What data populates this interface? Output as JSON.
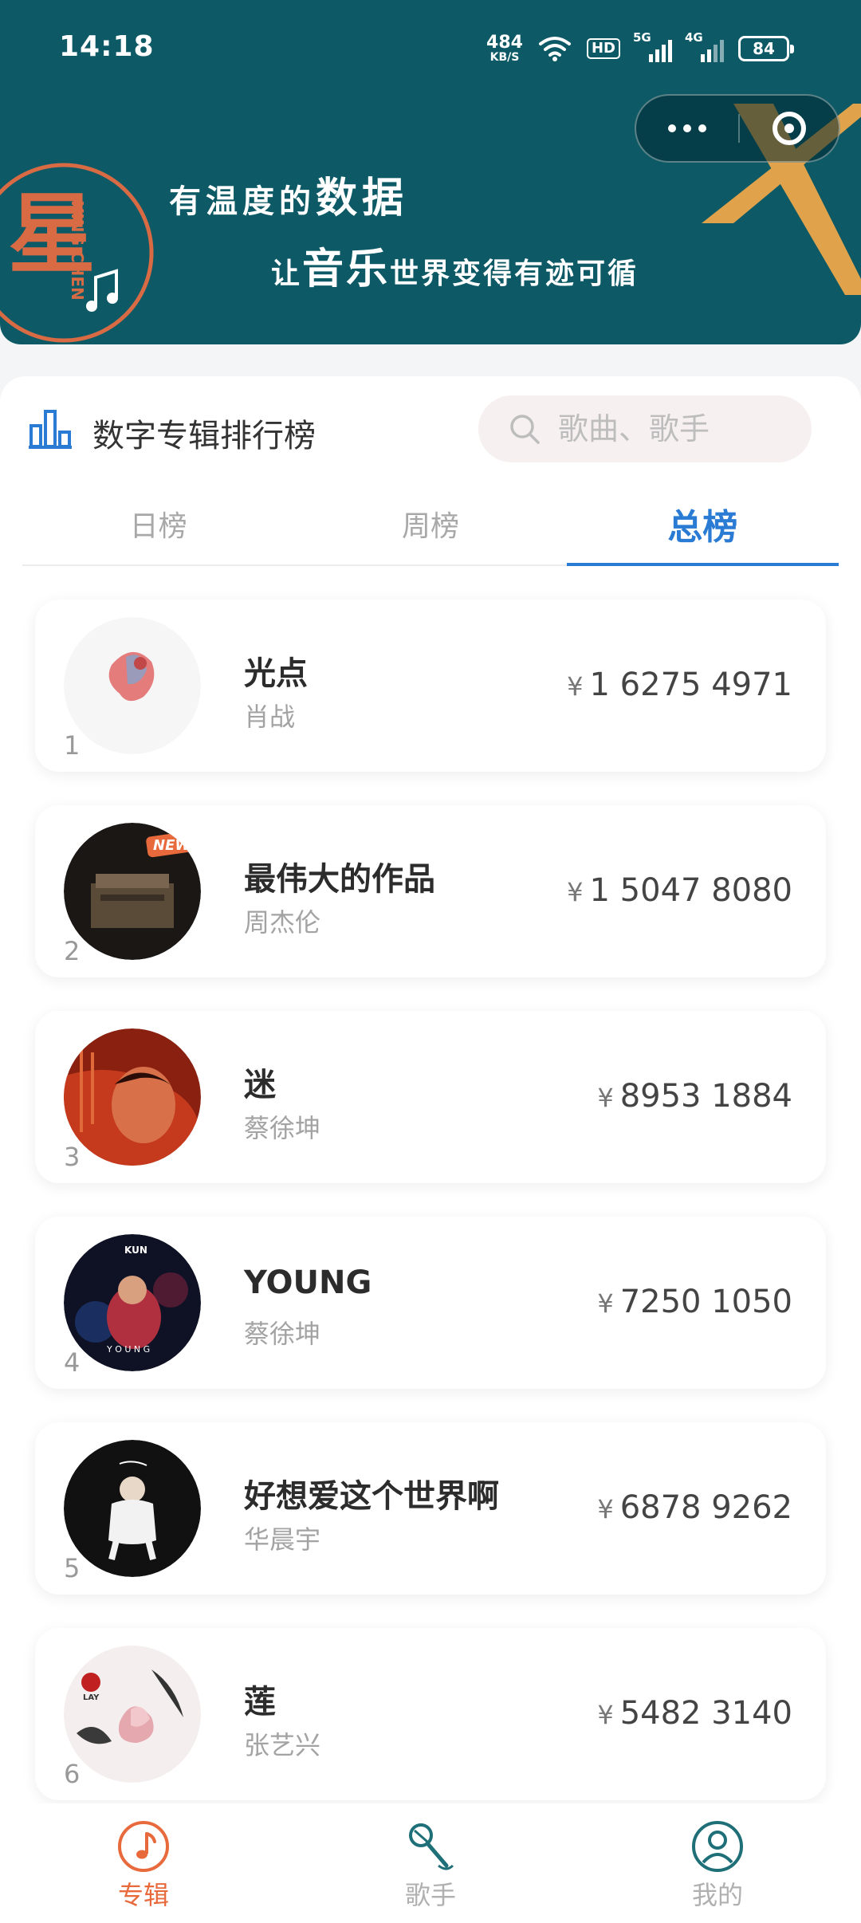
{
  "status_bar": {
    "time": "14:18",
    "net_speed_value": "484",
    "net_speed_unit": "KB/S",
    "hd_label": "HD",
    "signal_1": "5G",
    "signal_2": "4G",
    "battery": "84"
  },
  "banner": {
    "slogan_line1_a": "有温度的",
    "slogan_line1_b": "数据",
    "slogan_line2_a": "让",
    "slogan_line2_b": "音乐",
    "slogan_line2_c": "世界变得有迹可循",
    "logo_text": "XING CHEN",
    "logo_glyph": "星",
    "accent_color": "#e0a24a",
    "background_color": "#0d5a66"
  },
  "section": {
    "title": "数字专辑排行榜",
    "search_placeholder": "歌曲、歌手"
  },
  "tabs": [
    {
      "label": "日榜",
      "active": false
    },
    {
      "label": "周榜",
      "active": false
    },
    {
      "label": "总榜",
      "active": true
    }
  ],
  "ranking": [
    {
      "rank": "1",
      "title": "光点",
      "artist": "肖战",
      "currency": "¥",
      "amount": "1 6275 4971",
      "cover": "heart-art-cover"
    },
    {
      "rank": "2",
      "title": "最伟大的作品",
      "artist": "周杰伦",
      "currency": "¥",
      "amount": "1 5047 8080",
      "cover": "piano-cover"
    },
    {
      "rank": "3",
      "title": "迷",
      "artist": "蔡徐坤",
      "currency": "¥",
      "amount": "8953 1884",
      "cover": "red-portrait-cover"
    },
    {
      "rank": "4",
      "title": "YOUNG",
      "artist": "蔡徐坤",
      "currency": "¥",
      "amount": "7250 1050",
      "cover": "young-cover"
    },
    {
      "rank": "5",
      "title": "好想爱这个世界啊",
      "artist": "华晨宇",
      "currency": "¥",
      "amount": "6878 9262",
      "cover": "sitting-figure-cover"
    },
    {
      "rank": "6",
      "title": "莲",
      "artist": "张艺兴",
      "currency": "¥",
      "amount": "5482 3140",
      "cover": "lotus-cover"
    }
  ],
  "cover_badges": {
    "new_badge": "NEW",
    "young_letters": "Y O U N G",
    "kun_label": "KUN",
    "lay_label": "LAY"
  },
  "bottom_nav": [
    {
      "label": "专辑",
      "icon": "music-note-icon",
      "active": true
    },
    {
      "label": "歌手",
      "icon": "microphone-icon",
      "active": false
    },
    {
      "label": "我的",
      "icon": "user-icon",
      "active": false
    }
  ],
  "colors": {
    "primary": "#2a7bd4",
    "nav_active": "#e86a3c",
    "banner": "#0d5a66"
  }
}
